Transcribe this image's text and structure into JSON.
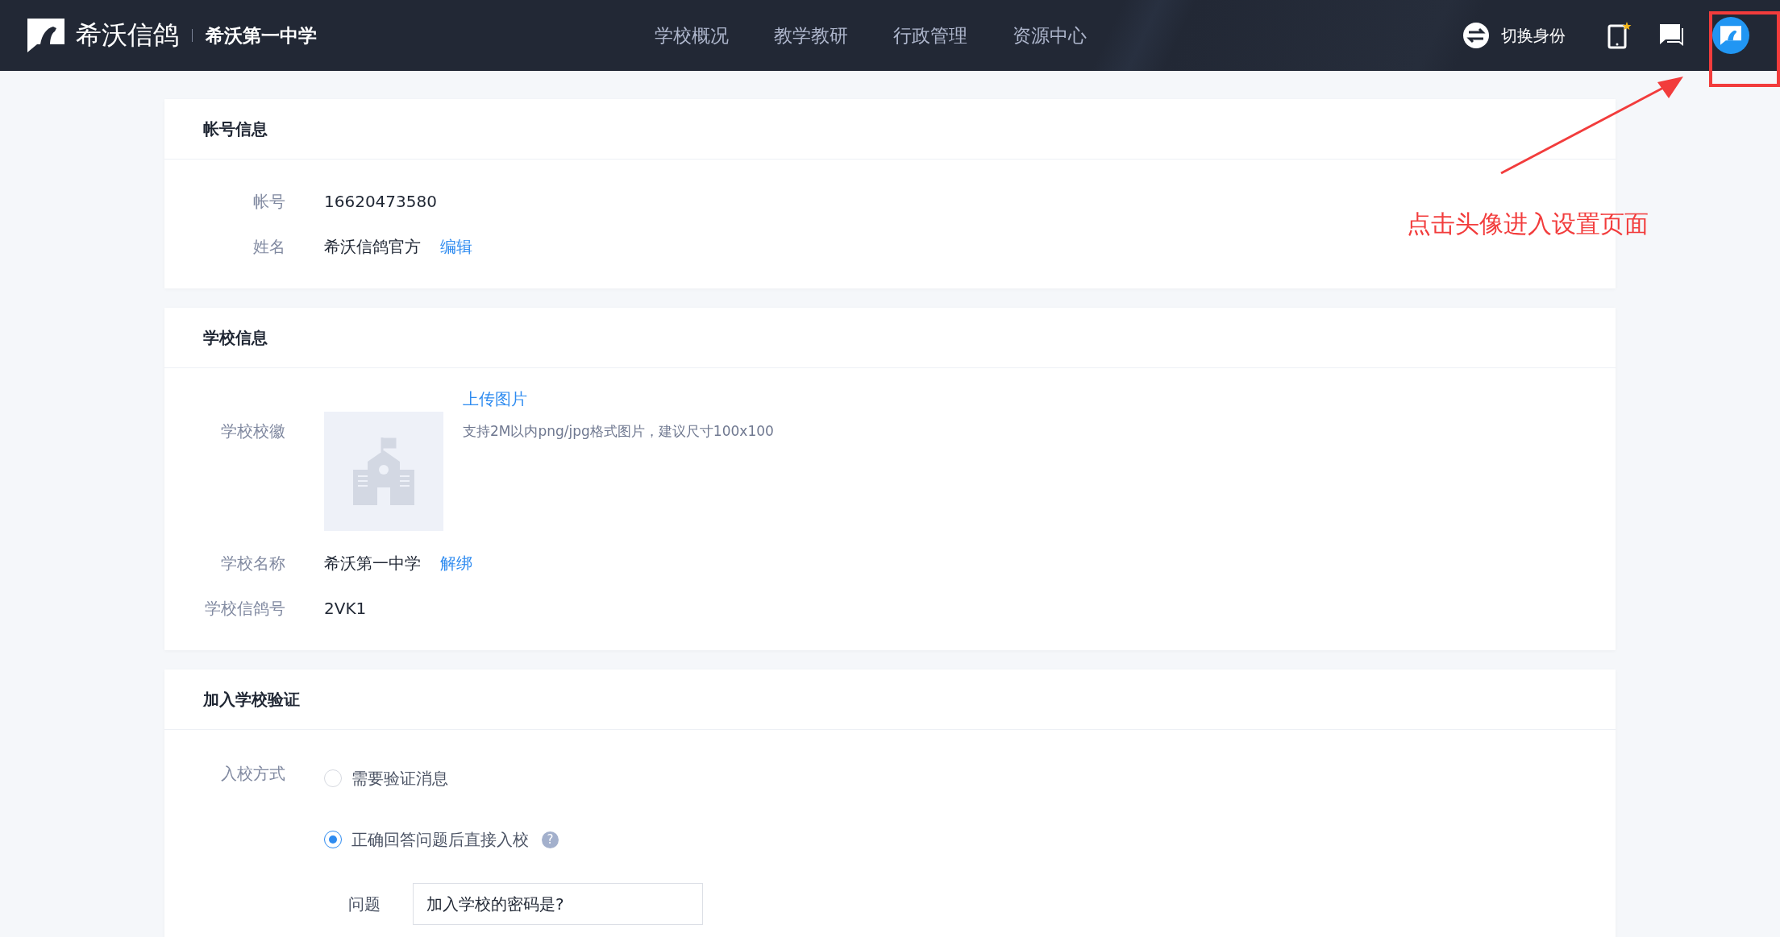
{
  "header": {
    "brand": "希沃信鸽",
    "school": "希沃第一中学",
    "nav": [
      "学校概况",
      "教学教研",
      "行政管理",
      "资源中心"
    ],
    "switch_identity": "切换身份"
  },
  "account": {
    "title": "帐号信息",
    "rows": [
      {
        "label": "帐号",
        "value": "16620473580"
      },
      {
        "label": "姓名",
        "value": "希沃信鸽官方",
        "link": "编辑"
      }
    ]
  },
  "school": {
    "title": "学校信息",
    "logo_label": "学校校徽",
    "upload": "上传图片",
    "hint": "支持2M以内png/jpg格式图片，建议尺寸100x100",
    "rows": [
      {
        "label": "学校名称",
        "value": "希沃第一中学",
        "link": "解绑"
      },
      {
        "label": "学校信鸽号",
        "value": "2VK1"
      }
    ]
  },
  "join": {
    "title": "加入学校验证",
    "label": "入校方式",
    "options": [
      {
        "label": "需要验证消息",
        "selected": false
      },
      {
        "label": "正确回答问题后直接入校",
        "selected": true,
        "help": "?"
      }
    ],
    "question_label": "问题",
    "question_value": "加入学校的密码是?"
  },
  "annotation": {
    "text": "点击头像进入设置页面"
  }
}
